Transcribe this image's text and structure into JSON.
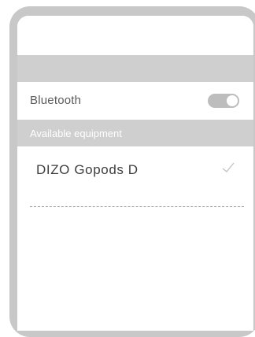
{
  "settings": {
    "bluetooth_label": "Bluetooth",
    "bluetooth_enabled": true,
    "available_header": "Available equipment",
    "devices": [
      {
        "name": "DIZO Gopods D",
        "connected": true,
        "status_icon": "check-icon"
      }
    ]
  },
  "colors": {
    "frame": "#c8c8c8",
    "band": "#cfcfcf",
    "toggle": "#bdbdbd",
    "text": "#5a5a5a"
  }
}
